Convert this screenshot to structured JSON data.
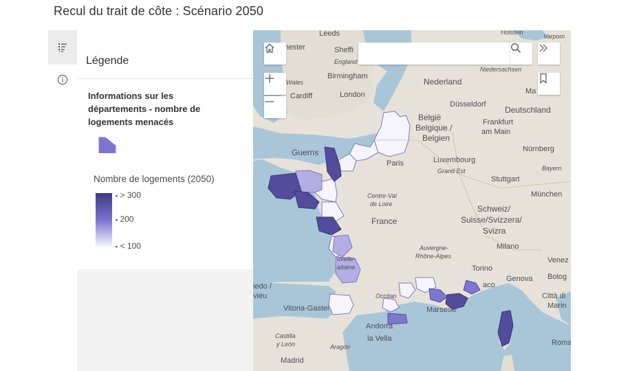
{
  "app": {
    "title": "Recul du trait de côte : Scénario 2050"
  },
  "legend": {
    "header": "Légende",
    "layer_title": "Informations sur les départements - nombre de logements menacés",
    "field_title": "Nombre de logements (2050)",
    "ramp_labels": [
      "> 300",
      "200",
      "< 100"
    ],
    "ramp_colors": {
      "high": "#3f3a7e",
      "mid": "#7a73d1",
      "low": "#f6f5ff"
    },
    "swatch_color": "#7b74d3"
  },
  "search": {
    "placeholder": ""
  },
  "map_labels": {
    "leeds": "Leeds",
    "manchester": "chester",
    "sheffield": "Sheffi",
    "england": "England",
    "birmingham": "Birmingham",
    "wales": "Wales",
    "cardiff": "Cardiff",
    "london": "London",
    "nederland": "Nederland",
    "niedersachsen": "Niedersachsen",
    "duesseldorf": "Düsseldorf",
    "deutschland": "Deutschland",
    "belgie1": "België",
    "belgie2": "Belgique /",
    "belgie3": "Belgien",
    "frankfurt1": "Frankfurt",
    "frankfurt2": "am Main",
    "nuernberg": "Nürnberg",
    "bayern": "Bayern",
    "luxembourg": "Luxembourg",
    "grand_est": "Grand Est",
    "guernsey": "Guerns",
    "paris": "Paris",
    "stuttgart": "Stuttgart",
    "muenchen": "München",
    "centre1": "Centre-Val",
    "centre2": "de Loire",
    "france": "France",
    "schweiz1": "Schweiz/",
    "schweiz2": "Suisse/Svizzera/",
    "schweiz3": "Svizra",
    "auvergne1": "Auvergne-",
    "auvergne2": "Rhône-Alpes",
    "milano": "Milano",
    "nouvelle1": "uvelle-",
    "nouvelle2": "aitaine",
    "torino": "Torino",
    "venezia": "Venez",
    "genova": "Genova",
    "bologna": "Bolog",
    "occitanie": "Occitan",
    "monaco": "aco",
    "vitoria": "Vitoria-Gastei",
    "pais_vasco1": "iedo /",
    "pais_vasco2": "viéu",
    "marseille": "Marseille",
    "citta1": "Città di",
    "citta2": "Marin",
    "andorra1": "Andorra",
    "andorra2": "la Vella",
    "castilla1": "Castilla",
    "castilla2": "y León",
    "aragon": "Aragón",
    "roma": "Roma",
    "madrid": "Madrid",
    "holstein": "Holstein",
    "varpom": "Varpom",
    "ma": "Ma"
  }
}
